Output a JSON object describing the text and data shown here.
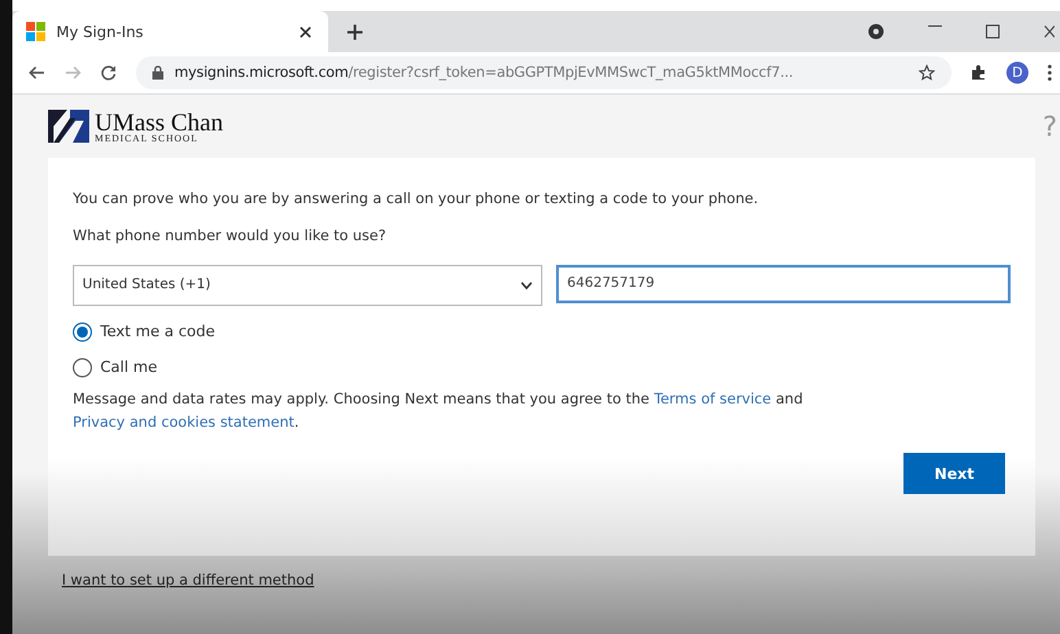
{
  "browser": {
    "tab_title": "My Sign-Ins",
    "url_domain": "mysignins.microsoft.com",
    "url_path": "/register?csrf_token=abGGPTMpjEvMMSwcT_maG5ktMMoccf7...",
    "profile_initial": "D"
  },
  "header": {
    "logo_name": "UMass Chan",
    "logo_sub": "MEDICAL SCHOOL",
    "help": "?"
  },
  "intro": "You can prove who you are by answering a call on your phone or texting a code to your phone.",
  "question": "What phone number would you like to use?",
  "country": {
    "value": "United States (+1)"
  },
  "phone": {
    "value": "6462757179"
  },
  "options": [
    {
      "label": "Text me a code",
      "selected": true
    },
    {
      "label": "Call me",
      "selected": false
    }
  ],
  "consent": [
    {
      "kind": "text",
      "text": "Message and data rates may apply. Choosing Next means that you agree to the "
    },
    {
      "kind": "link",
      "text": "Terms of service"
    },
    {
      "kind": "text",
      "text": " and "
    },
    {
      "kind": "link",
      "text": "Privacy and cookies statement"
    },
    {
      "kind": "text",
      "text": "."
    }
  ],
  "next_button": "Next",
  "other_method": "I want to set up a different method"
}
